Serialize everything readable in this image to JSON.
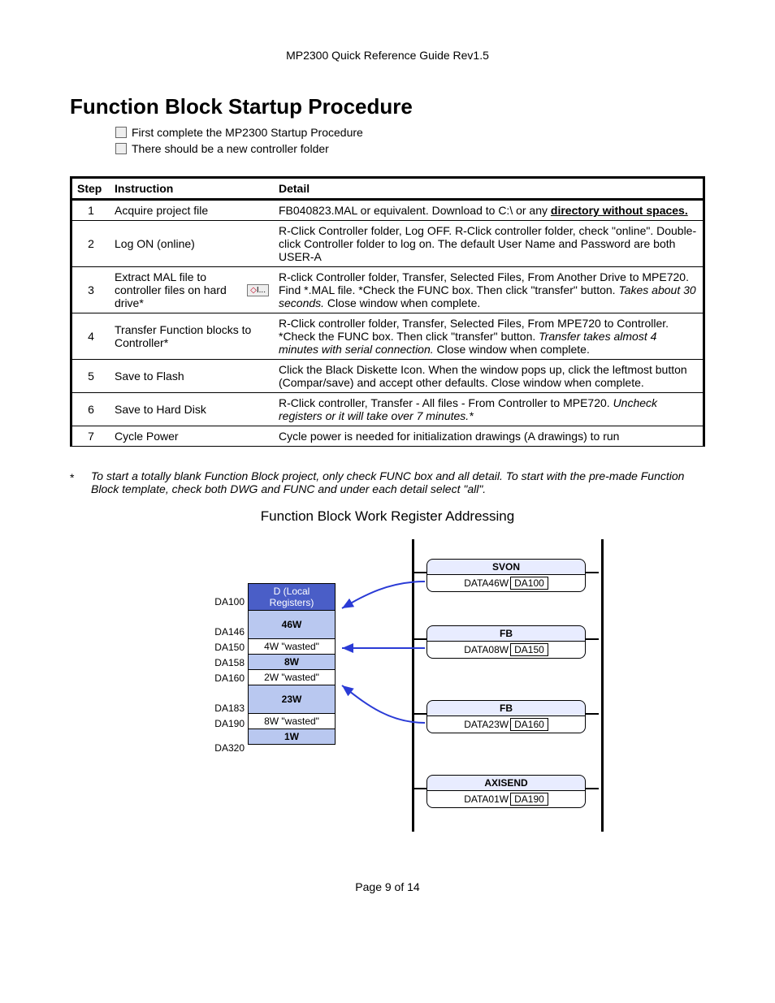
{
  "header": "MP2300 Quick Reference Guide Rev1.5",
  "title": "Function Block Startup Procedure",
  "checklist": [
    "First complete the MP2300 Startup Procedure",
    "There should be a new controller folder"
  ],
  "table": {
    "headers": {
      "step": "Step",
      "instruction": "Instruction",
      "detail": "Detail"
    },
    "rows": [
      {
        "step": "1",
        "instruction": "Acquire project file",
        "detail_pre": "FB040823.MAL or equivalent.  Download to C:\\ or any ",
        "detail_bold_u": "directory without spaces.",
        "detail_post": ""
      },
      {
        "step": "2",
        "instruction": "Log ON (online)",
        "detail": "R-Click Controller folder, Log OFF.  R-Click controller folder, check \"online\".  Double-click Controller folder to log on.  The default User Name and Password are both USER-A"
      },
      {
        "step": "3",
        "instruction": "Extract MAL file to controller files on hard drive*",
        "icon_text": "I...",
        "detail_pre": "R-click Controller folder, Transfer, Selected Files, From Another Drive to MPE720.  Find *.MAL file.  *Check the FUNC box.  Then click \"transfer\" button. ",
        "detail_italic": "Takes about 30 seconds.",
        "detail_post": "   Close window when complete."
      },
      {
        "step": "4",
        "instruction": "Transfer Function blocks to Controller*",
        "detail_pre": "R-Click controller folder, Transfer, Selected Files, From MPE720 to Controller.  *Check the FUNC box.  Then click \"transfer\" button.  ",
        "detail_italic": "Transfer takes almost 4 minutes with serial connection.",
        "detail_post": "  Close window when complete."
      },
      {
        "step": "5",
        "instruction": "Save to Flash",
        "detail": "Click the Black Diskette Icon.  When the window pops up, click the leftmost button (Compar/save) and accept other defaults.  Close window when complete."
      },
      {
        "step": "6",
        "instruction": "Save to Hard Disk",
        "detail_pre": "R-Click controller, Transfer - All files  - From Controller to MPE720.  ",
        "detail_italic": "Uncheck registers or it will take over 7 minutes.*",
        "detail_post": ""
      },
      {
        "step": "7",
        "instruction": "Cycle Power",
        "detail": "Cycle power is needed for initialization drawings (A drawings) to run"
      }
    ]
  },
  "footnote_marker": "*",
  "footnote": "To start a totally blank Function Block project, only check FUNC box and all detail.  To start with the pre-made Function Block template, check both DWG and FUNC and under each detail select \"all\".",
  "diagram_title": "Function Block Work Register Addressing",
  "diagram": {
    "reg_header": "D (Local Registers)",
    "labels": [
      "DA100",
      "DA146",
      "DA150",
      "DA158",
      "DA160",
      "DA183",
      "DA190",
      "DA320"
    ],
    "cells": [
      {
        "text": "46W",
        "used": true
      },
      {
        "text": "4W \"wasted\"",
        "used": false
      },
      {
        "text": "8W",
        "used": true
      },
      {
        "text": "2W \"wasted\"",
        "used": false
      },
      {
        "text": "23W",
        "used": true
      },
      {
        "text": "8W \"wasted\"",
        "used": false
      },
      {
        "text": "1W",
        "used": true
      }
    ],
    "fb": [
      {
        "title": "SVON",
        "data": "DATA46W",
        "da": "DA100"
      },
      {
        "title": "FB",
        "data": "DATA08W",
        "da": "DA150"
      },
      {
        "title": "FB",
        "data": "DATA23W",
        "da": "DA160"
      },
      {
        "title": "AXISEND",
        "data": "DATA01W",
        "da": "DA190"
      }
    ]
  },
  "page_number": "Page 9 of 14"
}
